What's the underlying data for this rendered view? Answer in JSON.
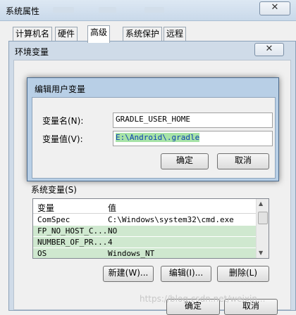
{
  "system_properties": {
    "title": "系统属性",
    "close_glyph": "✕",
    "tabs": [
      "计算机名",
      "硬件",
      "高级",
      "系统保护",
      "远程"
    ],
    "active_tab": "高级",
    "footer": {
      "ok": "确定",
      "cancel": "取消"
    }
  },
  "env_window": {
    "title": "环境变量",
    "close_glyph": "✕",
    "system_vars_label": "系统变量(S)",
    "columns": {
      "name": "变量",
      "value": "值"
    },
    "rows": [
      {
        "name": "ComSpec",
        "value": "C:\\Windows\\system32\\cmd.exe"
      },
      {
        "name": "FP_NO_HOST_C...",
        "value": "NO"
      },
      {
        "name": "NUMBER_OF_PR...",
        "value": "4"
      },
      {
        "name": "OS",
        "value": "Windows_NT"
      }
    ],
    "buttons": {
      "new": "新建(W)...",
      "edit": "编辑(I)...",
      "delete": "删除(L)"
    }
  },
  "edit_dialog": {
    "title": "编辑用户变量",
    "name_label": "变量名(N):",
    "value_label": "变量值(V):",
    "name_value": "GRADLE_USER_HOME",
    "value_value": "E:\\Android\\.gradle",
    "ok": "确定",
    "cancel": "取消"
  },
  "watermark": "https://blog.csdn.net/weixin..."
}
